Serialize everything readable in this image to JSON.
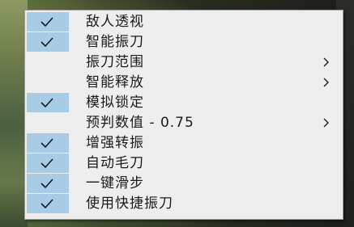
{
  "menu": {
    "items": [
      {
        "label": "敌人透视",
        "checked": true,
        "submenu": false
      },
      {
        "label": "智能振刀",
        "checked": true,
        "submenu": false
      },
      {
        "label": "振刀范围",
        "checked": false,
        "submenu": true
      },
      {
        "label": "智能释放",
        "checked": false,
        "submenu": true
      },
      {
        "label": "模拟锁定",
        "checked": true,
        "submenu": false
      },
      {
        "label": "预判数值 - 0.75",
        "checked": false,
        "submenu": true
      },
      {
        "label": "增强转振",
        "checked": true,
        "submenu": false
      },
      {
        "label": "自动毛刀",
        "checked": true,
        "submenu": false
      },
      {
        "label": "一键滑步",
        "checked": true,
        "submenu": false
      },
      {
        "label": "使用快捷振刀",
        "checked": true,
        "submenu": false
      }
    ]
  },
  "colors": {
    "check_highlight": "#a8cbe6",
    "menu_background": "#eeeeee",
    "text": "#1a1a1a"
  },
  "icons": {
    "check": "checkmark-icon",
    "submenu": "chevron-right-icon"
  }
}
